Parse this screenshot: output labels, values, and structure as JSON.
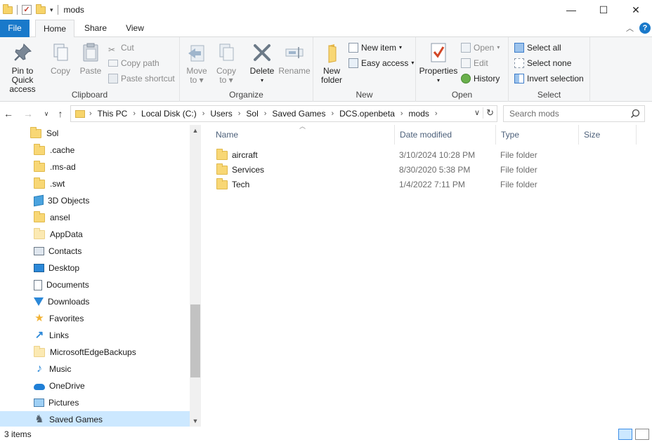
{
  "window": {
    "title": "mods",
    "controls": {
      "minimize": "—",
      "maximize": "☐",
      "close": "✕"
    }
  },
  "ribbon_tabs": {
    "file": "File",
    "home": "Home",
    "share": "Share",
    "view": "View"
  },
  "ribbon": {
    "clipboard": {
      "label": "Clipboard",
      "pin_line1": "Pin to Quick",
      "pin_line2": "access",
      "copy": "Copy",
      "paste": "Paste",
      "cut": "Cut",
      "copy_path": "Copy path",
      "paste_shortcut": "Paste shortcut"
    },
    "organize": {
      "label": "Organize",
      "move_to_1": "Move",
      "move_to_2": "to",
      "copy_to_1": "Copy",
      "copy_to_2": "to",
      "delete": "Delete",
      "rename": "Rename"
    },
    "new": {
      "label": "New",
      "new_folder_1": "New",
      "new_folder_2": "folder",
      "new_item": "New item",
      "easy_access": "Easy access"
    },
    "open": {
      "label": "Open",
      "properties": "Properties",
      "open": "Open",
      "edit": "Edit",
      "history": "History"
    },
    "select": {
      "label": "Select",
      "select_all": "Select all",
      "select_none": "Select none",
      "invert": "Invert selection"
    }
  },
  "address": {
    "breadcrumbs": [
      "This PC",
      "Local Disk (C:)",
      "Users",
      "Sol",
      "Saved Games",
      "DCS.openbeta",
      "mods"
    ],
    "search_placeholder": "Search mods"
  },
  "nav_tree": [
    {
      "label": "Sol",
      "icon": "folder-icon",
      "indent": 1
    },
    {
      "label": ".cache",
      "icon": "folder-icon",
      "indent": 2
    },
    {
      "label": ".ms-ad",
      "icon": "folder-icon",
      "indent": 2
    },
    {
      "label": ".swt",
      "icon": "folder-icon",
      "indent": 2
    },
    {
      "label": "3D Objects",
      "icon": "3d-objects-icon",
      "indent": 2
    },
    {
      "label": "ansel",
      "icon": "folder-icon",
      "indent": 2
    },
    {
      "label": "AppData",
      "icon": "folder-pale-icon",
      "indent": 2
    },
    {
      "label": "Contacts",
      "icon": "contacts-icon",
      "indent": 2
    },
    {
      "label": "Desktop",
      "icon": "desktop-icon",
      "indent": 2
    },
    {
      "label": "Documents",
      "icon": "documents-icon",
      "indent": 2
    },
    {
      "label": "Downloads",
      "icon": "downloads-icon",
      "indent": 2
    },
    {
      "label": "Favorites",
      "icon": "favorites-icon",
      "indent": 2
    },
    {
      "label": "Links",
      "icon": "links-icon",
      "indent": 2
    },
    {
      "label": "MicrosoftEdgeBackups",
      "icon": "folder-pale-icon",
      "indent": 2
    },
    {
      "label": "Music",
      "icon": "music-icon",
      "indent": 2
    },
    {
      "label": "OneDrive",
      "icon": "onedrive-icon",
      "indent": 2
    },
    {
      "label": "Pictures",
      "icon": "pictures-icon",
      "indent": 2
    },
    {
      "label": "Saved Games",
      "icon": "saved-games-icon",
      "indent": 2,
      "selected": true
    }
  ],
  "columns": {
    "name": "Name",
    "date": "Date modified",
    "type": "Type",
    "size": "Size"
  },
  "files": [
    {
      "name": "aircraft",
      "date": "3/10/2024 10:28 PM",
      "type": "File folder"
    },
    {
      "name": "Services",
      "date": "8/30/2020 5:38 PM",
      "type": "File folder"
    },
    {
      "name": "Tech",
      "date": "1/4/2022 7:11 PM",
      "type": "File folder"
    }
  ],
  "status": {
    "items": "3 items"
  },
  "colors": {
    "accent": "#1979ca",
    "selected": "#cce8ff",
    "folder": "#f8d775"
  }
}
